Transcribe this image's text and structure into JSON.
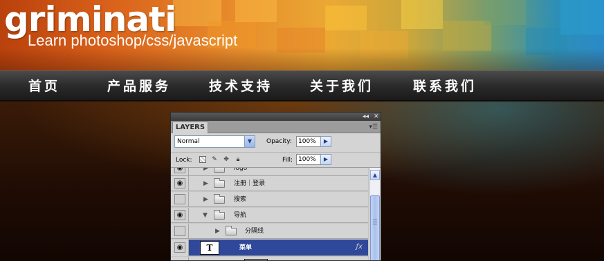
{
  "site": {
    "title": "griminati",
    "tagline": "Learn photoshop/css/javascript"
  },
  "nav": {
    "items": [
      "首页",
      "产品服务",
      "技术支持",
      "关于我们",
      "联系我们"
    ]
  },
  "colors": {
    "nav_bar": "#2b2b2b",
    "selected_layer": "#30489a",
    "banner_orange": "#d9611a",
    "banner_blue": "#2a8ac8"
  },
  "layers_panel": {
    "collapse_icon": "double-chevron-left-icon",
    "close_icon": "close-icon",
    "tab_label": "LAYERS",
    "blend_mode": "Normal",
    "opacity_label": "Opacity:",
    "opacity_value": "100%",
    "lock_label": "Lock:",
    "fill_label": "Fill:",
    "fill_value": "100%",
    "layers": [
      {
        "name": "logo",
        "type": "group",
        "expanded": false,
        "visible": true,
        "indent": 0
      },
      {
        "name": "注册｜登录",
        "type": "group",
        "expanded": false,
        "visible": true,
        "indent": 0
      },
      {
        "name": "搜索",
        "type": "group",
        "expanded": false,
        "visible": false,
        "indent": 0
      },
      {
        "name": "导航",
        "type": "group",
        "expanded": true,
        "visible": true,
        "indent": 0
      },
      {
        "name": "分隔线",
        "type": "group",
        "expanded": false,
        "visible": false,
        "indent": 1
      },
      {
        "name": "菜单",
        "type": "text",
        "thumb": "T",
        "selected": true,
        "visible": true,
        "indent": 1
      }
    ]
  }
}
